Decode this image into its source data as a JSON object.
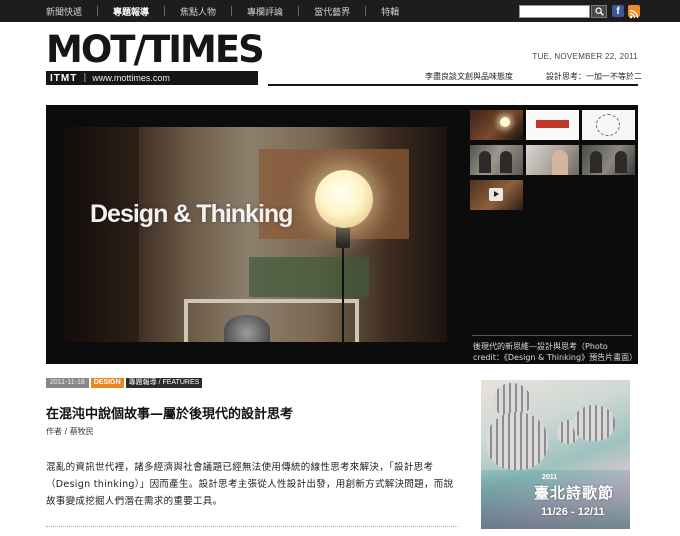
{
  "nav": {
    "items": [
      {
        "label": "新聞快遞",
        "active": false
      },
      {
        "label": "專題報導",
        "active": true
      },
      {
        "label": "焦點人物",
        "active": false
      },
      {
        "label": "專欄評論",
        "active": false
      },
      {
        "label": "當代藝界",
        "active": false
      },
      {
        "label": "特輯",
        "active": false
      }
    ],
    "search_value": "",
    "icons": [
      "search-icon",
      "facebook-icon",
      "rss-icon"
    ]
  },
  "masthead": {
    "logo": "MOT/TIMES",
    "logo_badge": "ITMT",
    "logo_url": "www.mottimes.com",
    "date": "TUE, NOVEMBER 22, 2011",
    "headlines": [
      "李盡良談文創與品味態度",
      "設計思考：一加一不等於二"
    ]
  },
  "feature": {
    "hero_text": "Design & Thinking",
    "caption": "後現代的新思維—設計與思考（Photo credit：《Design & Thinking》預告片畫面）",
    "thumbnails": [
      {
        "name": "thumb-1"
      },
      {
        "name": "thumb-2"
      },
      {
        "name": "thumb-3"
      },
      {
        "name": "thumb-4"
      },
      {
        "name": "thumb-5"
      },
      {
        "name": "thumb-6"
      },
      {
        "name": "thumb-7-video",
        "video": true
      }
    ]
  },
  "article": {
    "date_tag": "2011-11-18",
    "category": "DESIGN",
    "section": "專題報導 / FEATURES",
    "title": "在混沌中說個故事—屬於後現代的設計思考",
    "byline": "作者 / 蔡牧民",
    "body": "混亂的資訊世代裡，諸多經濟與社會議題已經無法使用傳統的線性思考來解決，「設計思考（Design thinking）」因而產生。設計思考主張從人性設計出發，用創新方式解決問題，而說故事變成挖掘人們潛在需求的重要工具。"
  },
  "ad": {
    "year": "2011",
    "title": "臺北詩歌節",
    "dates": "11/26 - 12/11"
  },
  "colors": {
    "nav_bg": "#1d1d1d",
    "category_tag": "#e8871e",
    "facebook": "#3b5998",
    "rss": "#f08a24"
  }
}
